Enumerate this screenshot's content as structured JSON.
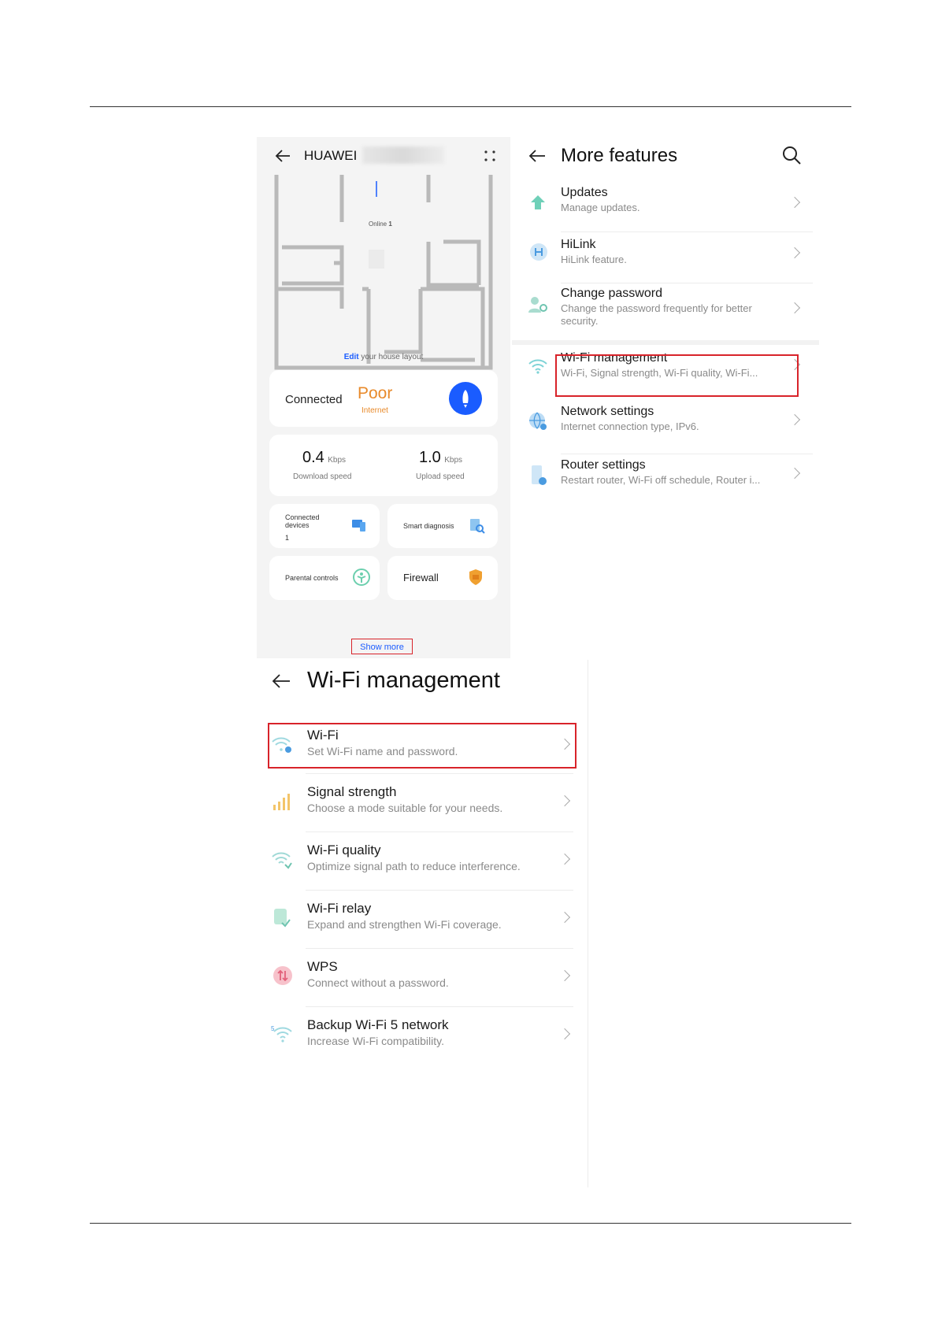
{
  "home": {
    "brand": "HUAWEI",
    "online_label": "Online",
    "online_count": "1",
    "edit_link": "Edit",
    "edit_rest": "your house layout",
    "status": {
      "connected": "Connected",
      "quality": "Poor",
      "quality_sub": "Internet"
    },
    "speed": {
      "download_value": "0.4",
      "download_unit": "Kbps",
      "download_label": "Download speed",
      "upload_value": "1.0",
      "upload_unit": "Kbps",
      "upload_label": "Upload speed"
    },
    "tiles": {
      "connected_devices": "Connected devices",
      "connected_count": "1",
      "smart_diagnosis": "Smart diagnosis",
      "parental_controls": "Parental controls",
      "firewall": "Firewall"
    },
    "show_more": "Show more"
  },
  "more": {
    "title": "More features",
    "items": [
      {
        "title": "Updates",
        "sub": "Manage updates."
      },
      {
        "title": "HiLink",
        "sub": "HiLink feature."
      },
      {
        "title": "Change password",
        "sub": "Change the password frequently for better security."
      },
      {
        "title": "Wi-Fi management",
        "sub": "Wi-Fi, Signal strength, Wi-Fi quality, Wi-Fi..."
      },
      {
        "title": "Network settings",
        "sub": "Internet connection type, IPv6."
      },
      {
        "title": "Router settings",
        "sub": "Restart router, Wi-Fi off schedule, Router i..."
      }
    ]
  },
  "wifi": {
    "title": "Wi-Fi management",
    "items": [
      {
        "title": "Wi-Fi",
        "sub": "Set Wi-Fi name and password."
      },
      {
        "title": "Signal strength",
        "sub": "Choose a mode suitable for your needs."
      },
      {
        "title": "Wi-Fi quality",
        "sub": "Optimize signal path to reduce interference."
      },
      {
        "title": "Wi-Fi relay",
        "sub": "Expand and strengthen Wi-Fi coverage."
      },
      {
        "title": "WPS",
        "sub": "Connect without a password."
      },
      {
        "title": "Backup Wi-Fi 5 network",
        "sub": "Increase Wi-Fi compatibility."
      }
    ]
  },
  "colors": {
    "accent_red": "#d8232a",
    "poor_orange": "#e88a2b",
    "blue": "#1a5cff",
    "icon_teal": "#7ed3d6"
  }
}
